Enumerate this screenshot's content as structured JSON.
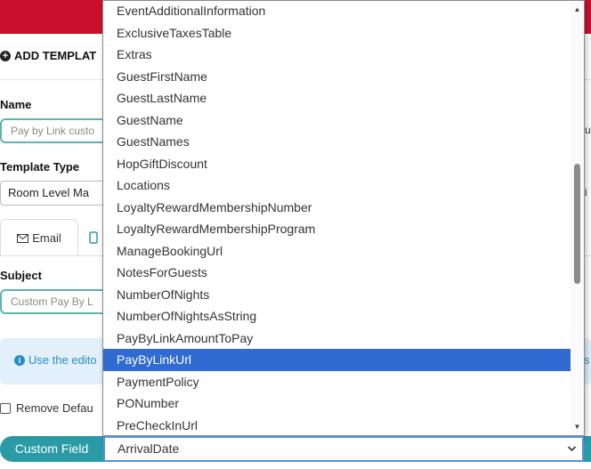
{
  "form": {
    "add_template": "ADD TEMPLAT",
    "name_label": "Name",
    "name_value": "Pay by Link custo",
    "template_type_label": "Template Type",
    "template_type_value": "Room Level Ma",
    "tab_email": "Email",
    "subject_label": "Subject",
    "subject_value": "Custom Pay By L",
    "info_text": "Use the edito",
    "info_right": "s",
    "remove_default": "Remove Defau",
    "custom_field_button": "Custom Field",
    "edge_u": "u",
    "edge_i": "i"
  },
  "dropdown": {
    "items": [
      "EventAdditionalInformation",
      "ExclusiveTaxesTable",
      "Extras",
      "GuestFirstName",
      "GuestLastName",
      "GuestName",
      "GuestNames",
      "HopGiftDiscount",
      "Locations",
      "LoyaltyRewardMembershipNumber",
      "LoyaltyRewardMembershipProgram",
      "ManageBookingUrl",
      "NotesForGuests",
      "NumberOfNights",
      "NumberOfNightsAsString",
      "PayByLinkAmountToPay",
      "PayByLinkUrl",
      "PaymentPolicy",
      "PONumber",
      "PreCheckInUrl"
    ],
    "selected": "PayByLinkUrl",
    "current_value": "ArrivalDate"
  },
  "colors": {
    "brand_red": "#c8102e",
    "teal": "#2a9aa6",
    "highlight": "#2f6bd0",
    "info_bg": "#e1f0fa"
  }
}
